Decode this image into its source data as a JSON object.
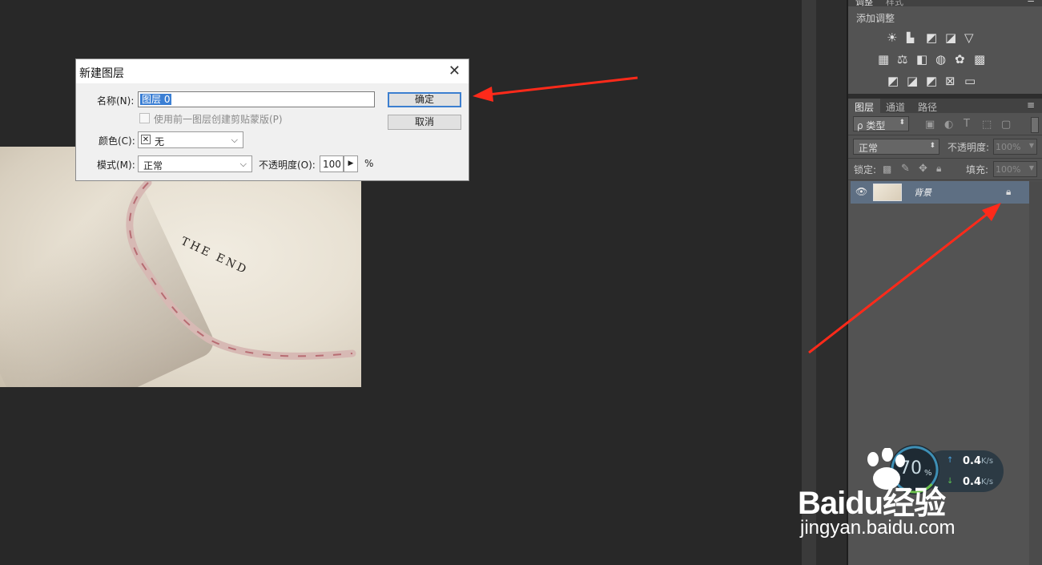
{
  "dialog": {
    "title": "新建图层",
    "name_label": "名称(N):",
    "name_value": "图层 0",
    "clip_checkbox_label": "使用前一图层创建剪贴蒙版(P)",
    "color_label": "颜色(C):",
    "color_value": "无",
    "mode_label": "模式(M):",
    "mode_value": "正常",
    "opacity_label": "不透明度(O):",
    "opacity_value": "100",
    "opacity_unit": "%",
    "ok_label": "确定",
    "cancel_label": "取消"
  },
  "canvas": {
    "photo_text": "THE END"
  },
  "panels": {
    "top_tabs": [
      "调整",
      "样式"
    ],
    "adjust_title": "添加调整",
    "layers_tabs": [
      "图层",
      "通道",
      "路径"
    ],
    "kind_filter": "ρ 类型",
    "blend_mode": "正常",
    "opacity_label": "不透明度:",
    "opacity_value": "100%",
    "lock_label": "锁定:",
    "fill_label": "填充:",
    "fill_value": "100%",
    "layer_name": "背景"
  },
  "network": {
    "percent": "70",
    "percent_unit": "%",
    "up_value": "0.4",
    "up_unit": "K/s",
    "down_value": "0.4",
    "down_unit": "K/s"
  },
  "watermark": {
    "brand": "Baidu经验",
    "url": "jingyan.baidu.com"
  },
  "colors": {
    "arrow": "#ff2a1a",
    "selected_layer": "#5e6f83",
    "primary_button_border": "#3c7fd0"
  }
}
